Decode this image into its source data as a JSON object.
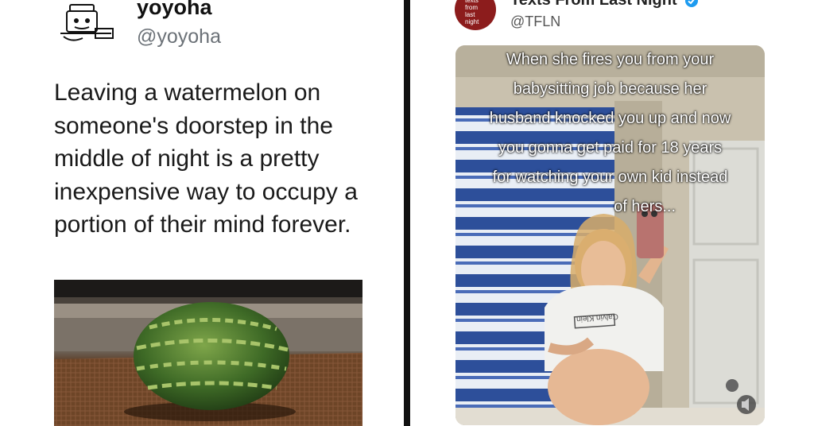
{
  "left_post": {
    "username": "yoyoha",
    "handle": "@yoyoha",
    "text": "Leaving a watermelon on someone's doorstep in the middle of night is a pretty inexpensive way to occupy a portion of their mind forever."
  },
  "right_post": {
    "account_name": "Texts From Last Night",
    "handle": "@TFLN",
    "avatar_lines": [
      "texts",
      "from",
      "last",
      "night"
    ],
    "caption_lines": [
      "When she fires you from your",
      "babysitting job because her",
      "husband knocked you up and now",
      "you gonna get paid for 18 years",
      "for watching your own kid instead",
      "of hers..."
    ],
    "shirt_text": "Calvin Klein"
  },
  "colors": {
    "divider": "#111111",
    "verified_badge": "#1d9bf0",
    "tfln_brand": "#8c1c1c"
  }
}
